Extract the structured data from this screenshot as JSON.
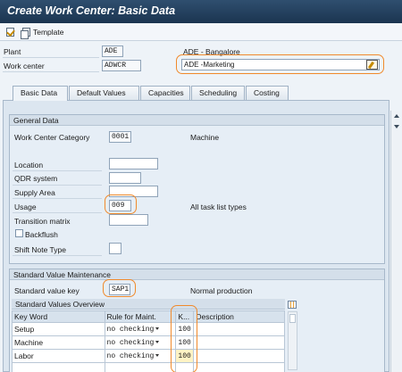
{
  "window": {
    "title": "Create Work Center: Basic Data"
  },
  "toolbar": {
    "template_label": "Template"
  },
  "header": {
    "plant_label": "Plant",
    "plant_value": "ADE",
    "plant_desc": "ADE - Bangalore",
    "workcenter_label": "Work center",
    "workcenter_value": "ADWCR",
    "workcenter_desc": "ADE -Marketing"
  },
  "tabs": [
    {
      "label": "Basic Data"
    },
    {
      "label": "Default Values"
    },
    {
      "label": "Capacities"
    },
    {
      "label": "Scheduling"
    },
    {
      "label": "Costing"
    }
  ],
  "general": {
    "title": "General Data",
    "category_label": "Work Center Category",
    "category_value": "0001",
    "category_desc": "Machine",
    "location_label": "Location",
    "qdr_label": "QDR system",
    "supply_label": "Supply Area",
    "usage_label": "Usage",
    "usage_value": "009",
    "usage_desc": "All task list types",
    "transition_label": "Transition matrix",
    "backflush_label": "Backflush",
    "shift_label": "Shift Note Type"
  },
  "standard": {
    "title": "Standard Value Maintenance",
    "key_label": "Standard value key",
    "key_value": "SAP1",
    "key_desc": "Normal production",
    "overview_title": "Standard Values Overview",
    "columns": [
      "Key Word",
      "Rule for Maint.",
      "K...",
      "Description"
    ],
    "rows": [
      {
        "keyword": "Setup",
        "rule": "no checking",
        "k": "100"
      },
      {
        "keyword": "Machine",
        "rule": "no checking",
        "k": "100"
      },
      {
        "keyword": "Labor",
        "rule": "no checking",
        "k": "100"
      }
    ]
  },
  "colors": {
    "highlight": "#f08a2c",
    "title_bg": "#1b3550"
  }
}
